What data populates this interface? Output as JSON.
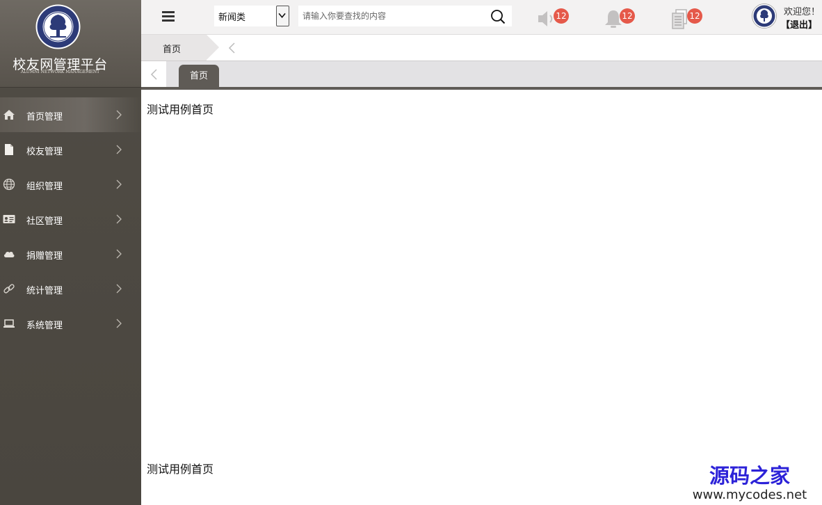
{
  "brand": {
    "title": "校友网管理平台",
    "subtitle": "ALUMNI NETWORK MANAGEMENT"
  },
  "sidebar": {
    "items": [
      {
        "label": "首页管理",
        "icon": "home-icon",
        "active": true
      },
      {
        "label": "校友管理",
        "icon": "document-icon",
        "active": false
      },
      {
        "label": "组织管理",
        "icon": "globe-icon",
        "active": false
      },
      {
        "label": "社区管理",
        "icon": "id-card-icon",
        "active": false
      },
      {
        "label": "捐赠管理",
        "icon": "cloud-icon",
        "active": false
      },
      {
        "label": "统计管理",
        "icon": "link-icon",
        "active": false
      },
      {
        "label": "系统管理",
        "icon": "laptop-icon",
        "active": false
      }
    ]
  },
  "header": {
    "category_value": "新闻类",
    "search_placeholder": "请输入你要查找的内容",
    "notifications": {
      "speaker_count": "12",
      "bell_count": "12",
      "doc_count": "12"
    },
    "welcome": "欢迎您！",
    "logout": "【退出】"
  },
  "breadcrumb": {
    "current": "首页"
  },
  "tabs": [
    {
      "label": "首页"
    }
  ],
  "content": {
    "line1": "测试用例首页",
    "line2": "测试用例首页"
  },
  "watermark": {
    "title": "源码之家",
    "url": "www.mycodes.net"
  },
  "colors": {
    "sidebar_bg": "#4a463f",
    "tab_active": "#5f5b56",
    "badge": "#e5594a",
    "watermark_blue": "#2c22d8"
  }
}
